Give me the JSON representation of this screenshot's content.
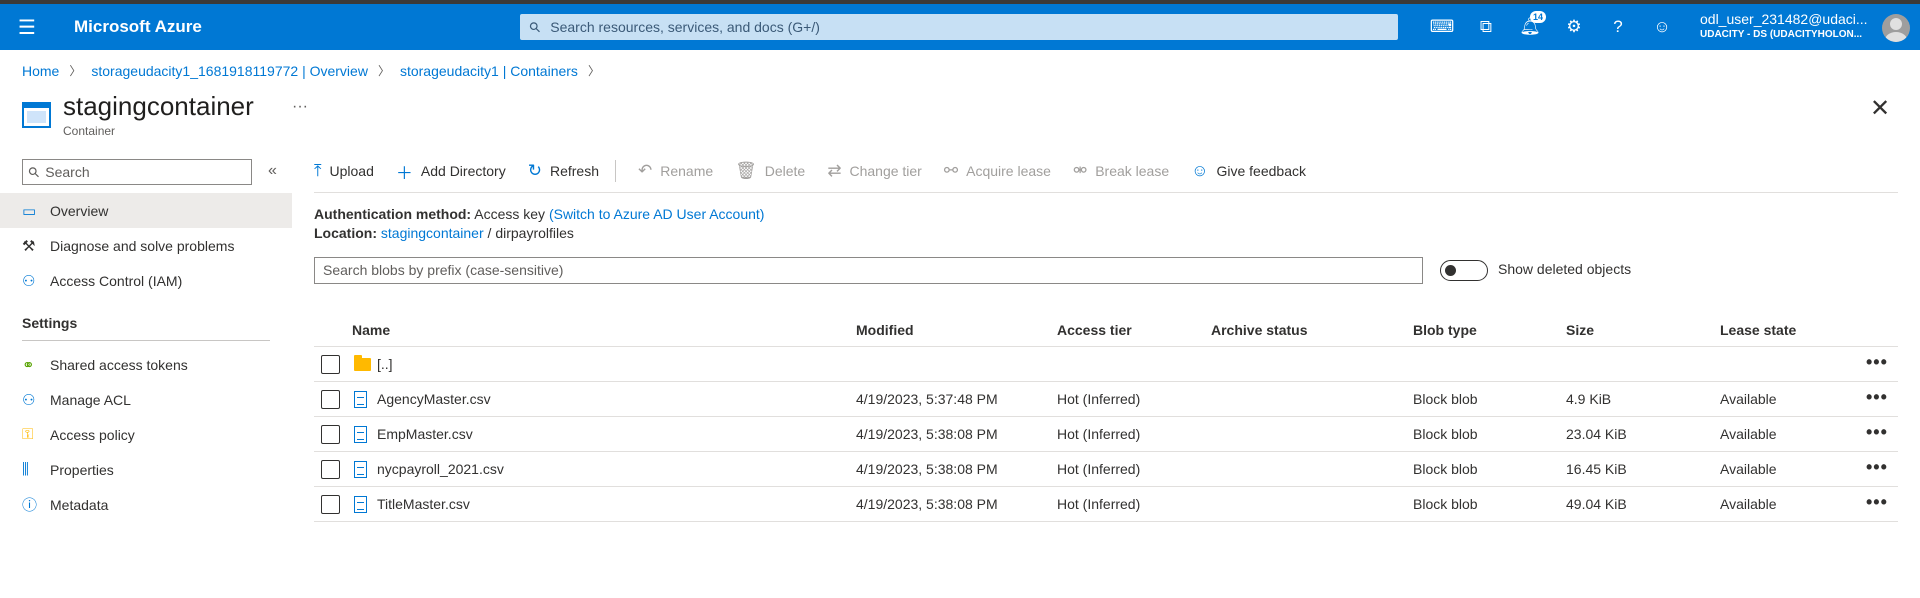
{
  "header": {
    "brand": "Microsoft Azure",
    "search_placeholder": "Search resources, services, and docs (G+/)",
    "notification_count": "14",
    "user_name": "odl_user_231482@udaci...",
    "user_tenant": "UDACITY - DS (UDACITYHOLON..."
  },
  "breadcrumb": {
    "items": [
      "Home",
      "storageudacity1_1681918119772 | Overview",
      "storageudacity1 | Containers"
    ]
  },
  "page": {
    "title": "stagingcontainer",
    "subtitle": "Container",
    "more": "···"
  },
  "sidebar": {
    "search_placeholder": "Search",
    "items": [
      {
        "label": "Overview"
      },
      {
        "label": "Diagnose and solve problems"
      },
      {
        "label": "Access Control (IAM)"
      }
    ],
    "settings_heading": "Settings",
    "settings_items": [
      {
        "label": "Shared access tokens"
      },
      {
        "label": "Manage ACL"
      },
      {
        "label": "Access policy"
      },
      {
        "label": "Properties"
      },
      {
        "label": "Metadata"
      }
    ]
  },
  "toolbar": {
    "upload": "Upload",
    "add_directory": "Add Directory",
    "refresh": "Refresh",
    "rename": "Rename",
    "delete": "Delete",
    "change_tier": "Change tier",
    "acquire_lease": "Acquire lease",
    "break_lease": "Break lease",
    "give_feedback": "Give feedback"
  },
  "auth": {
    "method_label": "Authentication method:",
    "method_value": "Access key",
    "switch_link": "(Switch to Azure AD User Account)",
    "location_label": "Location:",
    "location_link": "stagingcontainer",
    "location_sep": "/",
    "location_folder": "dirpayrolfiles"
  },
  "blob_search": {
    "placeholder": "Search blobs by prefix (case-sensitive)",
    "toggle_label": "Show deleted objects"
  },
  "table": {
    "columns": [
      "Name",
      "Modified",
      "Access tier",
      "Archive status",
      "Blob type",
      "Size",
      "Lease state"
    ],
    "parent_row": "[..]",
    "rows": [
      {
        "name": "AgencyMaster.csv",
        "modified": "4/19/2023, 5:37:48 PM",
        "tier": "Hot (Inferred)",
        "archive": "",
        "type": "Block blob",
        "size": "4.9 KiB",
        "lease": "Available"
      },
      {
        "name": "EmpMaster.csv",
        "modified": "4/19/2023, 5:38:08 PM",
        "tier": "Hot (Inferred)",
        "archive": "",
        "type": "Block blob",
        "size": "23.04 KiB",
        "lease": "Available"
      },
      {
        "name": "nycpayroll_2021.csv",
        "modified": "4/19/2023, 5:38:08 PM",
        "tier": "Hot (Inferred)",
        "archive": "",
        "type": "Block blob",
        "size": "16.45 KiB",
        "lease": "Available"
      },
      {
        "name": "TitleMaster.csv",
        "modified": "4/19/2023, 5:38:08 PM",
        "tier": "Hot (Inferred)",
        "archive": "",
        "type": "Block blob",
        "size": "49.04 KiB",
        "lease": "Available"
      }
    ],
    "row_menu": "•••"
  }
}
